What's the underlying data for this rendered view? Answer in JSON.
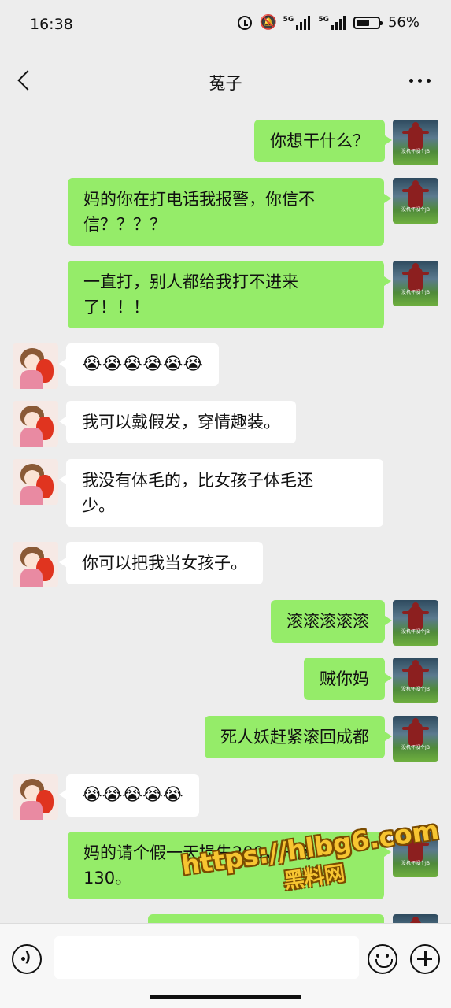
{
  "status_bar": {
    "time": "16:38",
    "network1": "5G",
    "network2": "5G",
    "battery": "56%"
  },
  "header": {
    "title": "菟子"
  },
  "avatars": {
    "me_caption": "没机怀没个JB"
  },
  "messages": [
    {
      "from": "me",
      "text": "你想干什么？"
    },
    {
      "from": "me",
      "text": "妈的你在打电话我报警，你信不\n信？？？？"
    },
    {
      "from": "me",
      "text": "一直打，别人都给我打不进来\n了！！！"
    },
    {
      "from": "her",
      "text": "😭😭😭😭😭😭"
    },
    {
      "from": "her",
      "text": "我可以戴假发，穿情趣装。"
    },
    {
      "from": "her",
      "text": "我没有体毛的，比女孩子体毛还\n少。"
    },
    {
      "from": "her",
      "text": "你可以把我当女孩子。"
    },
    {
      "from": "me",
      "text": "滚滚滚滚滚"
    },
    {
      "from": "me",
      "text": "贼你妈"
    },
    {
      "from": "me",
      "text": "死人妖赶紧滚回成都"
    },
    {
      "from": "her",
      "text": "😭😭😭😭😭"
    },
    {
      "from": "me",
      "text": "妈的请个假一天损失200，开房\n130。"
    },
    {
      "from": "me",
      "text": ""
    }
  ],
  "watermark": {
    "url": "https://hlbg6.com",
    "label": "黑料网"
  },
  "input": {
    "value": "",
    "placeholder": ""
  }
}
